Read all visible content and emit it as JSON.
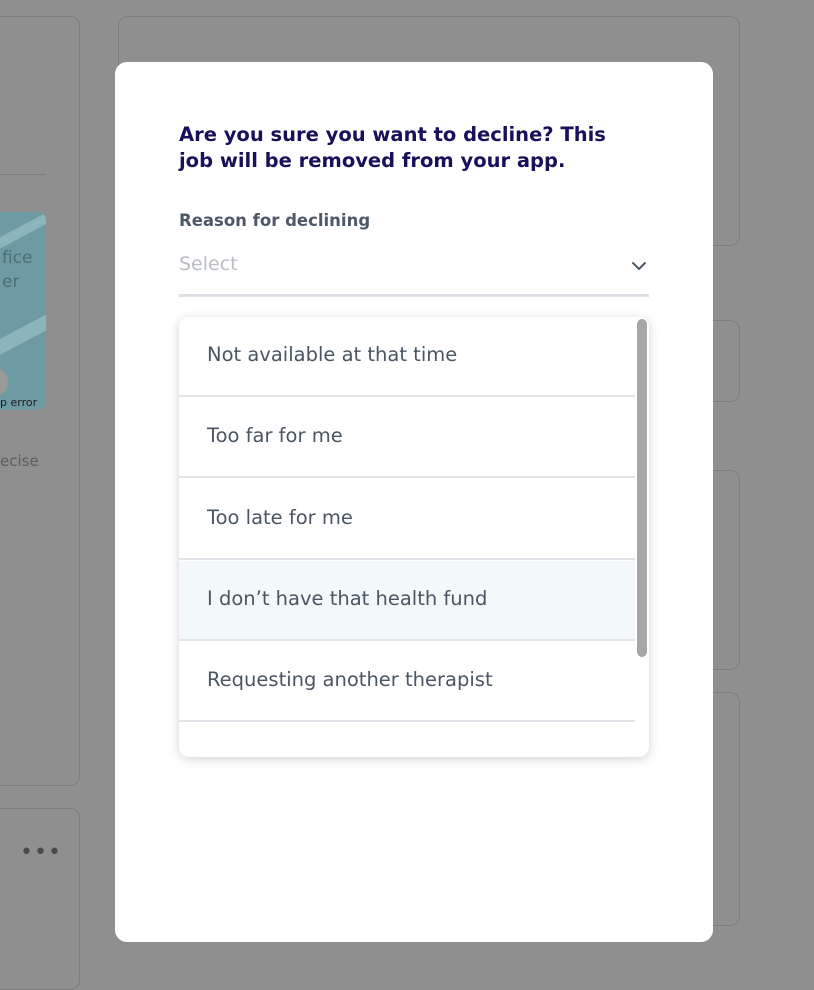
{
  "background": {
    "map_text_1": "fice",
    "map_text_2": "er",
    "map_pill": "...",
    "map_error": "p error",
    "text_fragment": "ecise",
    "more_label": "•••"
  },
  "modal": {
    "title": "Are you sure you want to decline? This job will be removed from your app.",
    "field_label": "Reason for declining",
    "select": {
      "placeholder": "Select",
      "icon": "chevron-down-icon"
    },
    "options": [
      {
        "label": "Not available at that time",
        "highlighted": false
      },
      {
        "label": "Too far for me",
        "highlighted": false
      },
      {
        "label": "Too late for me",
        "highlighted": false
      },
      {
        "label": "I don’t have that health fund",
        "highlighted": true
      },
      {
        "label": "Requesting another therapist",
        "highlighted": false
      }
    ]
  },
  "colors": {
    "title": "#17105a",
    "label": "#4e5968",
    "highlight": "#f3f9fa",
    "overlay": "#8f8f8f"
  }
}
